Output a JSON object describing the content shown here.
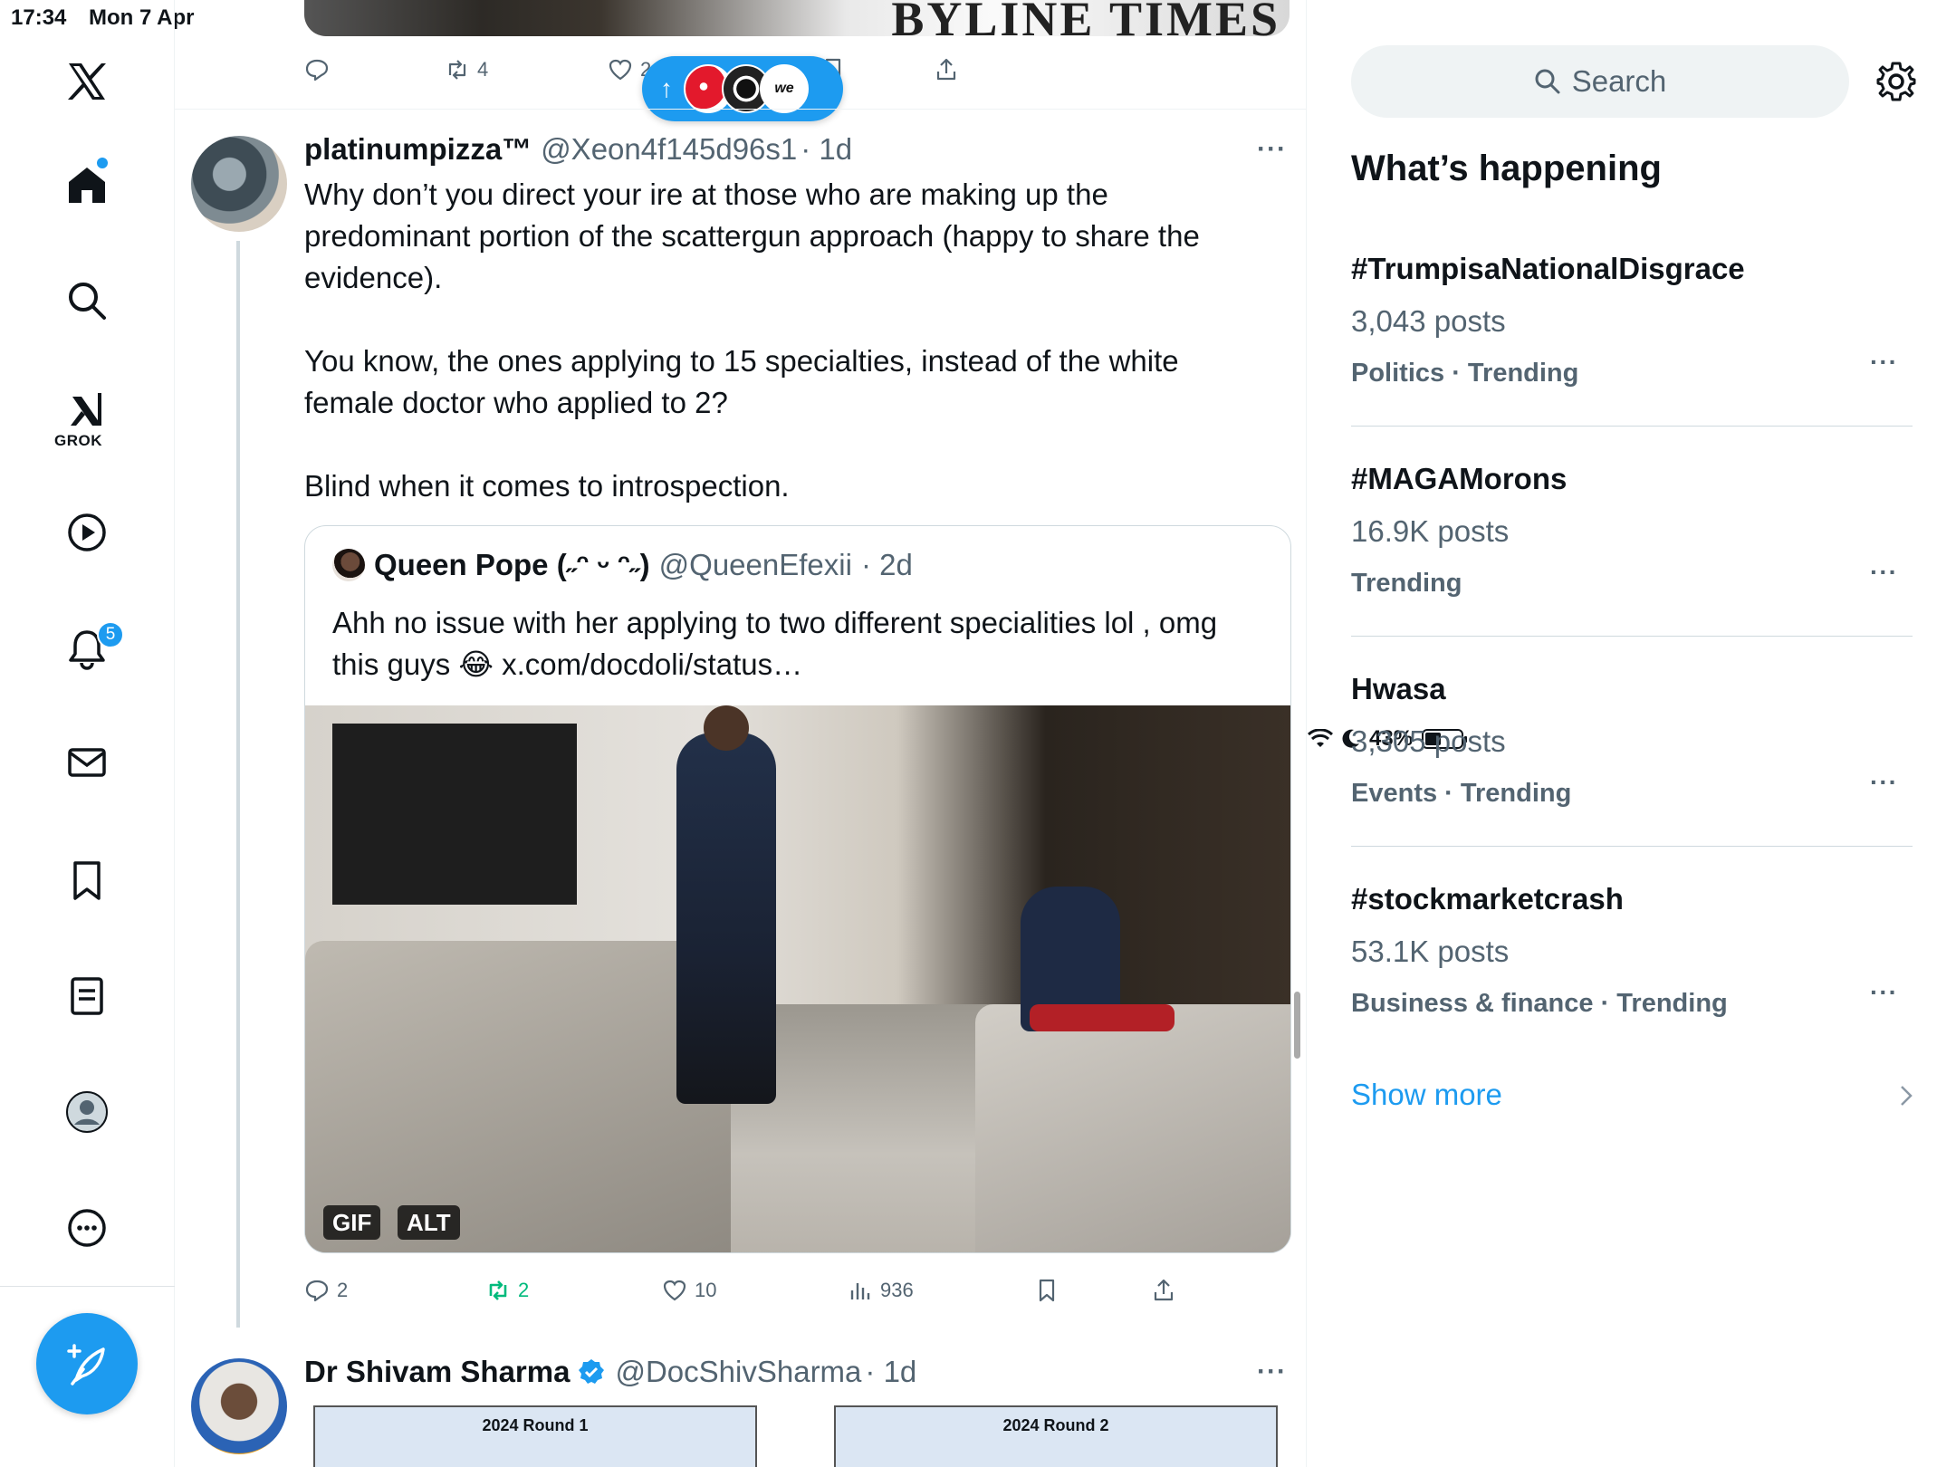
{
  "status": {
    "time": "17:34",
    "date": "Mon 7 Apr",
    "battery": "43%"
  },
  "nav": {
    "grok_label": "GROK",
    "notif_count": "5",
    "accent": "#1d9bf0"
  },
  "prev_tweet": {
    "media_text": "BYLINE TIMES",
    "retweets": "4",
    "likes": "2"
  },
  "tweet1": {
    "name": "platinumpizza™",
    "handle": "@Xeon4f145d96s1",
    "time": "· 1d",
    "paragraphs": [
      "Why don’t you direct your ire at those who are making up the predominant portion of the scattergun approach (happy to share the evidence).",
      "You know, the ones applying to 15 specialties, instead of the white female doctor who applied to 2?",
      "Blind when it comes to introspection."
    ],
    "quote": {
      "name": "Queen Pope (˶ᵔ ᵕ ᵔ˶)",
      "handle": "@QueenEfexii",
      "time": "· 2d",
      "text": "Ahh no issue with her applying to two different specialities lol , omg this guys 😂 x.com/docdoli/status…",
      "gif_label": "GIF",
      "alt_label": "ALT"
    },
    "replies": "2",
    "retweets": "2",
    "likes": "10",
    "views": "936"
  },
  "tweet2": {
    "name": "Dr Shivam Sharma",
    "handle": "@DocShivSharma",
    "time": "· 1d",
    "table1_title": "2024 Round 1",
    "table2_title": "2024 Round 2"
  },
  "sidebar": {
    "search_placeholder": "Search",
    "title": "What’s happening",
    "trends": [
      {
        "name": "#TrumpisaNationalDisgrace",
        "posts": "3,043 posts",
        "category": "Politics · Trending"
      },
      {
        "name": "#MAGAMorons",
        "posts": "16.9K posts",
        "category": "Trending"
      },
      {
        "name": "Hwasa",
        "posts": "3,305 posts",
        "category": "Events · Trending"
      },
      {
        "name": "#stockmarketcrash",
        "posts": "53.1K posts",
        "category": "Business & finance · Trending"
      }
    ],
    "show_more": "Show more"
  }
}
